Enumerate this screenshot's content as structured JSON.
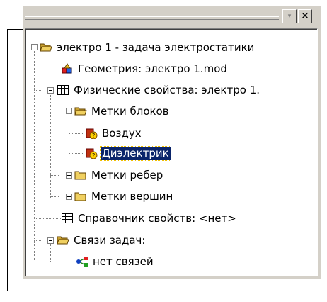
{
  "window": {
    "dropdown_glyph": "▾",
    "close_glyph": "✕"
  },
  "tree": {
    "root": {
      "label": "электро 1 - задача электростатики",
      "icon": "folder-open-icon",
      "expanded": true
    },
    "geometry": {
      "label": "Геометрия: электро 1.mod",
      "icon": "geometry-icon"
    },
    "physical": {
      "label": "Физические свойства: электро 1.",
      "icon": "table-icon",
      "expanded": true
    },
    "block_labels": {
      "label": "Метки блоков",
      "icon": "folder-open-icon",
      "expanded": true
    },
    "air": {
      "label": "Воздух",
      "icon": "label-unknown-icon"
    },
    "dielectric": {
      "label": "Диэлектрик",
      "icon": "label-unknown-icon",
      "selected": true
    },
    "edge_labels": {
      "label": "Метки ребер",
      "icon": "folder-closed-icon",
      "expanded": false
    },
    "vertex_labels": {
      "label": "Метки вершин",
      "icon": "folder-closed-icon",
      "expanded": false
    },
    "reference": {
      "label": "Справочник свойств: <нет>",
      "icon": "table-icon"
    },
    "links": {
      "label": "Связи задач:",
      "icon": "folder-open-icon",
      "expanded": true
    },
    "no_links": {
      "label": "нет связей",
      "icon": "link-icon"
    }
  },
  "colors": {
    "selection_bg": "#0a246a",
    "panel_bg": "#d4d0c8",
    "folder": "#f0d060"
  }
}
